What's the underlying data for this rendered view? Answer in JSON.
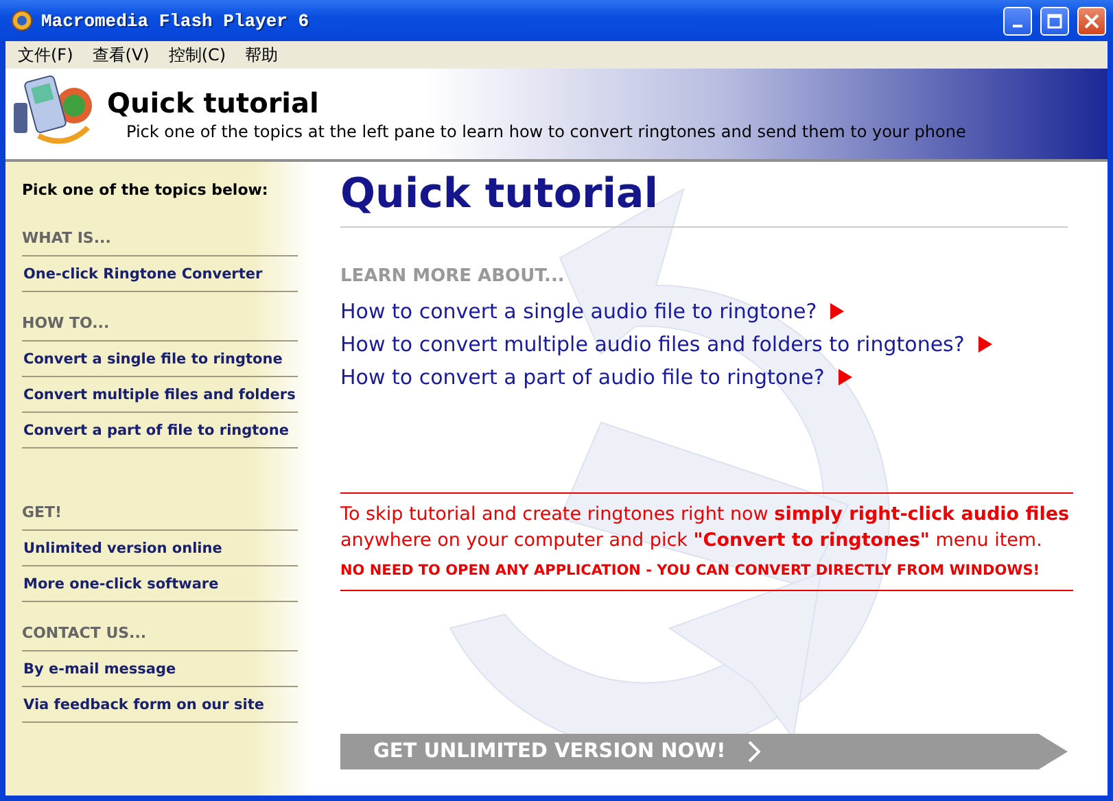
{
  "window": {
    "title": "Macromedia Flash Player 6"
  },
  "menu": [
    "文件(F)",
    "查看(V)",
    "控制(C)",
    "帮助"
  ],
  "header": {
    "title": "Quick tutorial",
    "subtitle": "Pick one of the topics at the left pane to learn how to convert ringtones and send them to your phone"
  },
  "sidebar": {
    "intro": "Pick one of the topics below:",
    "groups": [
      {
        "heading": "WHAT IS...",
        "items": [
          "One-click Ringtone Converter"
        ]
      },
      {
        "heading": "HOW TO...",
        "items": [
          "Convert a single file to ringtone",
          "Convert multiple files and folders",
          "Convert a part of file to ringtone"
        ]
      },
      {
        "heading": "GET!",
        "items": [
          "Unlimited version online",
          "More one-click software"
        ]
      },
      {
        "heading": "CONTACT US...",
        "items": [
          "By e-mail message",
          "Via feedback form on our site"
        ]
      }
    ]
  },
  "main": {
    "title": "Quick tutorial",
    "learn_heading": "LEARN MORE ABOUT...",
    "links": [
      "How to convert a single audio file to ringtone?",
      "How to convert multiple audio files and folders to ringtones?",
      "How to convert a part of audio file to ringtone?"
    ],
    "notice": "To skip tutorial and create ringtones right now **simply right-click audio files** anywhere on your computer and pick **\"Convert to ringtones\"** menu item.",
    "warning": "NO NEED TO OPEN ANY APPLICATION - YOU CAN CONVERT DIRECTLY FROM WINDOWS!",
    "cta": "GET UNLIMITED VERSION NOW!"
  }
}
